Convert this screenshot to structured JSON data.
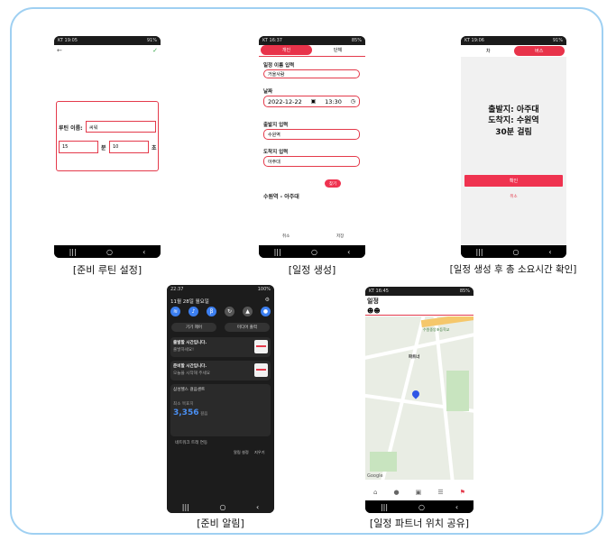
{
  "captions": {
    "routine": "[준비 루틴 설정]",
    "schedule": "[일정 생성]",
    "total_time": "[일정 생성 후 총 소요시간 확인]",
    "alarm": "[준비 알림]",
    "share": "[일정 파트너 위치 공유]"
  },
  "phone1": {
    "status_left": "KT 19:05",
    "status_right": "91%",
    "routine_label": "루틴 이름:",
    "routine_value": "씨워",
    "minutes_value": "15",
    "minutes_unit": "분",
    "seconds_value": "10",
    "seconds_unit": "초"
  },
  "phone2": {
    "status_left": "KT 16:37",
    "status_right": "85%",
    "tab_personal": "개인",
    "tab_group": "단체",
    "name_label": "일정 이름 입력",
    "name_value": "거을사람",
    "date_label": "날짜",
    "date_value": "2022-12-22",
    "time_value": "13:30",
    "departure_label": "출발지 입력",
    "departure_value": "수원역",
    "arrival_label": "도착지 입력",
    "arrival_value": "아주대",
    "search_button": "찾기",
    "route_text": "수원역 - 아주대",
    "cancel_button": "취소",
    "save_button": "저장"
  },
  "phone3": {
    "status_left": "KT 19:06",
    "status_right": "91%",
    "tab_left": "차",
    "tab_right": "버스",
    "departure": "출발지: 아주대",
    "arrival": "도착지: 수원역",
    "duration": "30분 걸림",
    "confirm_button": "확인",
    "cancel_button": "취소"
  },
  "phone4": {
    "time": "22:37",
    "battery": "100%",
    "date": "11월 28일 월요일",
    "device_control": "기기 제어",
    "media_output": "미디어 출력",
    "notif1_title": "출발할 시간입니다.",
    "notif1_body": "출발하세요!",
    "notif2_title": "준비할 시간입니다.",
    "notif2_body": "오늘을 시작해 주세요",
    "health_title": "삼성헬스 걸음센트",
    "steps_label": "최소 목표치",
    "steps_value": "3,356",
    "steps_unit": "걸음",
    "misc_row": "네트워크 트래 연동",
    "settings_link": "알림 설정",
    "clear_link": "지우기"
  },
  "phone5": {
    "status_left": "KT 16:45",
    "status_right": "85%",
    "title": "일정",
    "map_label": "파트너",
    "map_place_top": "수원중앙초등학교",
    "google_logo": "Google"
  }
}
